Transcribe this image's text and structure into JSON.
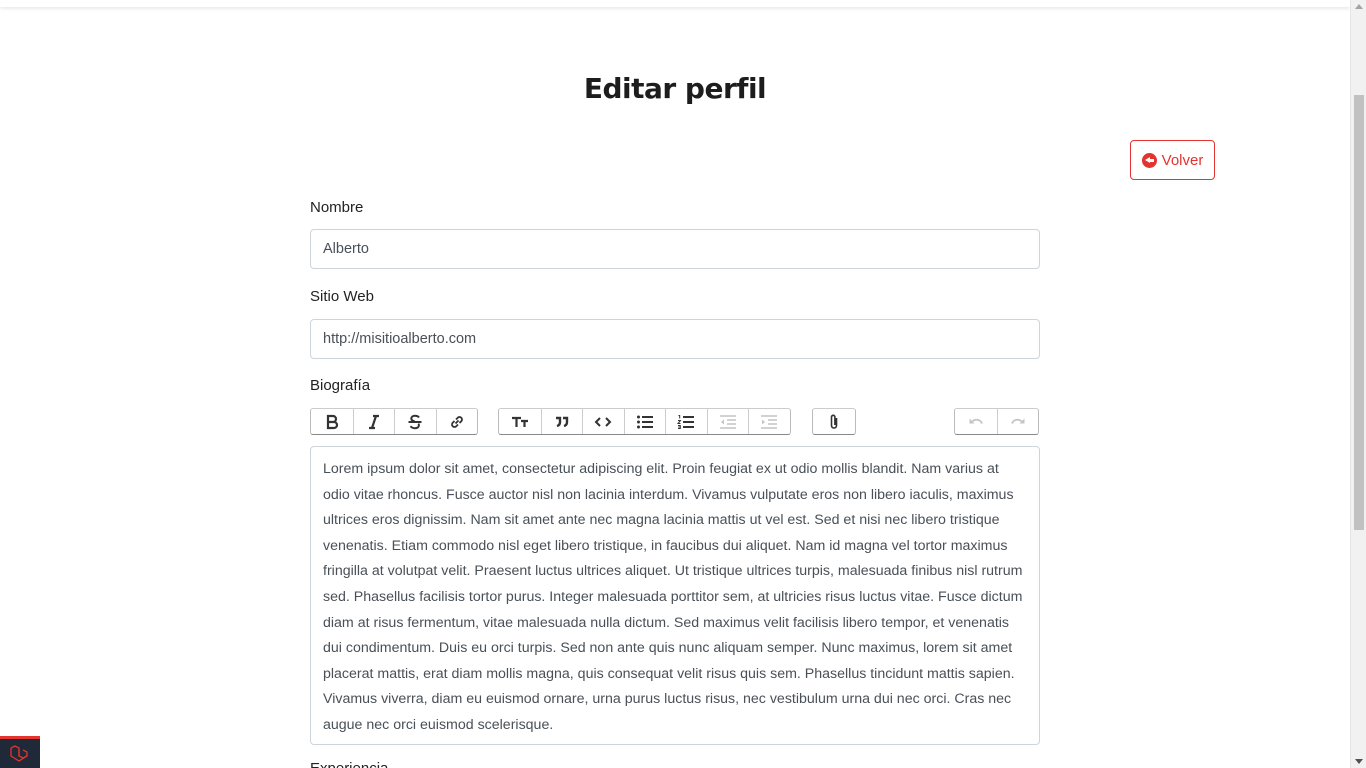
{
  "page": {
    "title": "Editar perfil"
  },
  "back_button": {
    "label": "Volver",
    "icon": "arrow-circle-left-icon"
  },
  "form": {
    "name": {
      "label": "Nombre",
      "value": "Alberto"
    },
    "website": {
      "label": "Sitio Web",
      "value": "http://misitioalberto.com"
    },
    "bio": {
      "label": "Biografía",
      "content": "Lorem ipsum dolor sit amet, consectetur adipiscing elit. Proin feugiat ex ut odio mollis blandit. Nam varius at odio vitae rhoncus. Fusce auctor nisl non lacinia interdum. Vivamus vulputate eros non libero iaculis, maximus ultrices eros dignissim. Nam sit amet ante nec magna lacinia mattis ut vel est. Sed et nisi nec libero tristique venenatis. Etiam commodo nisl eget libero tristique, in faucibus dui aliquet. Nam id magna vel tortor maximus fringilla at volutpat velit. Praesent luctus ultrices aliquet. Ut tristique ultrices turpis, malesuada finibus nisl rutrum sed. Phasellus facilisis tortor purus. Integer malesuada porttitor sem, at ultricies risus luctus vitae. Fusce dictum diam at risus fermentum, vitae malesuada nulla dictum. Sed maximus velit facilisis libero tempor, et venenatis dui condimentum. Duis eu orci turpis. Sed non ante quis nunc aliquam semper. Nunc maximus, lorem sit amet placerat mattis, erat diam mollis magna, quis consequat velit risus quis sem. Phasellus tincidunt mattis sapien. Vivamus viverra, diam eu euismod ornare, urna purus luctus risus, nec vestibulum urna dui nec orci. Cras nec augue nec orci euismod scelerisque."
    },
    "next_label": "Experiencia"
  },
  "toolbar": {
    "text_group": [
      "bold-icon",
      "italic-icon",
      "strikethrough-icon",
      "link-icon"
    ],
    "block_group": [
      "heading-icon",
      "quote-icon",
      "code-icon",
      "bullet-list-icon",
      "numbered-list-icon",
      "decrease-indent-icon",
      "increase-indent-icon"
    ],
    "file_group": [
      "attach-file-icon"
    ],
    "history_group": [
      "undo-icon",
      "redo-icon"
    ]
  },
  "colors": {
    "accent": "#e3342f",
    "text": "#495057",
    "border": "#ced4da"
  }
}
